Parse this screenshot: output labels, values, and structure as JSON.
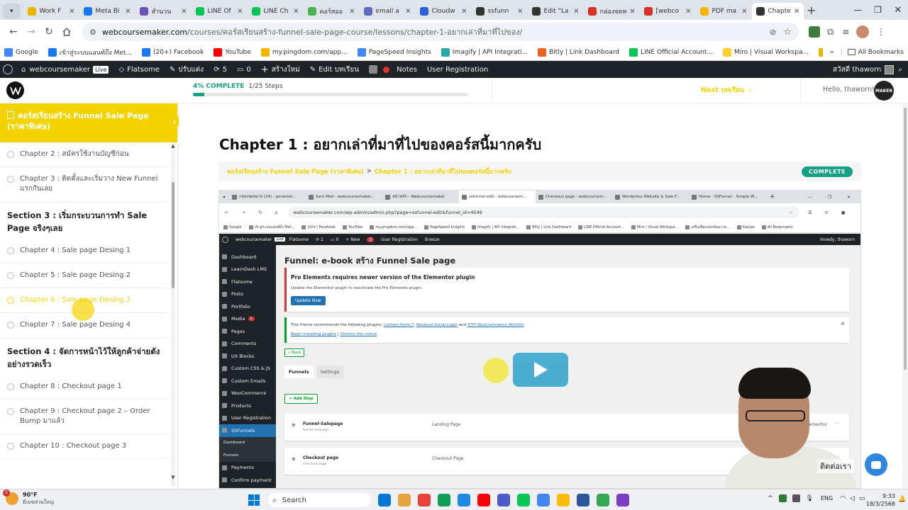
{
  "browser": {
    "tabs": [
      {
        "label": "Work F",
        "color": "#e8b400"
      },
      {
        "label": "Meta Bi",
        "color": "#1877f2"
      },
      {
        "label": "สำนวน",
        "color": "#6b4fbb"
      },
      {
        "label": "LINE Of",
        "color": "#06c755"
      },
      {
        "label": "LINE Ch",
        "color": "#06c755"
      },
      {
        "label": "คอร์สออ",
        "color": "#4caf50"
      },
      {
        "label": "email a",
        "color": "#5c6bc0"
      },
      {
        "label": "Cloudw",
        "color": "#2b5cd9"
      },
      {
        "label": "ssfunn",
        "color": "#333333"
      },
      {
        "label": "Edit \"La",
        "color": "#333333"
      },
      {
        "label": "กล่องจดห",
        "color": "#d93025"
      },
      {
        "label": "[webco",
        "color": "#d93025"
      },
      {
        "label": "PDF ma",
        "color": "#f4b400"
      },
      {
        "label": "Chapte",
        "color": "#333333"
      }
    ],
    "url_domain": "webcoursemaker.com",
    "url_path": "/courses/คอร์สเรียนสร้าง-funnel-sale-page-course/lessons/chapter-1-อยากเล่าที่มาที่ไปของ/",
    "bookmarks": [
      {
        "label": "Google",
        "color": "#4285f4"
      },
      {
        "label": "เข้าสู่ระบบแอนท์ถึง Met...",
        "color": "#1877f2"
      },
      {
        "label": "(20+) Facebook",
        "color": "#1877f2"
      },
      {
        "label": "YouTube",
        "color": "#ff0000"
      },
      {
        "label": "my.pingdom.com/app...",
        "color": "#f4b400"
      },
      {
        "label": "PageSpeed Insights",
        "color": "#4285f4"
      },
      {
        "label": "Imagify | API Integrati...",
        "color": "#2aa8a8"
      },
      {
        "label": "Bitly | Link Dashboard",
        "color": "#ee6123"
      },
      {
        "label": "LINE Official Account...",
        "color": "#06c755"
      },
      {
        "label": "Miro | Visual Workspa...",
        "color": "#ffd02f"
      },
      {
        "label": "เครื่องมือแปลงข้อความเป็...",
        "color": "#e8b400"
      },
      {
        "label": "Kaojao",
        "color": "#f4b400"
      }
    ],
    "all_bookmarks": "All Bookmarks"
  },
  "wpbar": {
    "site": "webcoursemaker",
    "live": "Live",
    "theme": "Flatsome",
    "customize": "ปรับแต่ง",
    "updates": "5",
    "comments": "0",
    "new": "สร้างใหม่",
    "edit": "Edit บทเรียน",
    "notes": "Notes",
    "user_reg": "User Registration",
    "howdy": "สวัสดี thaworn"
  },
  "progress": {
    "percent_label": "4% COMPLETE",
    "steps": "1/25 Steps",
    "fraction": 0.04,
    "next": "Next บทเรียน",
    "hello": "Hello, thaworn!",
    "maker": "MAKER"
  },
  "sidebar": {
    "course_title": "คอร์สเรียนสร้าง Funnel Sale Page (ราคาพิเศษ)",
    "items": [
      {
        "type": "lesson",
        "label": "Chapter 2 : สมัครใช้งานบัญชีก่อน"
      },
      {
        "type": "lesson",
        "label": "Chapter 3 : ติดตั้งและเริ่มวาง New Funnel แรกกันเลย"
      },
      {
        "type": "section",
        "label": "Section 3 : เริ่มกระบวนการทำ Sale Page จริงๆเลย"
      },
      {
        "type": "lesson",
        "label": "Chapter 4 : Sale page Desing 1"
      },
      {
        "type": "lesson",
        "label": "Chapter 5 : Sale page Desing 2"
      },
      {
        "type": "lesson-active",
        "label": "Chapter 6 : Sale page Desing 3"
      },
      {
        "type": "lesson",
        "label": "Chapter 7 : Sale page Desing 4"
      },
      {
        "type": "section",
        "label": "Section 4 : จัดการหน้าไว้ให้ลูกค้าจ่ายตังอย่างรวดเร็ว"
      },
      {
        "type": "lesson",
        "label": "Chapter 8 : Checkout page 1"
      },
      {
        "type": "lesson",
        "label": "Chapter 9 : Checkout page 2 – Order Bump มาแล้ว"
      },
      {
        "type": "lesson",
        "label": "Chapter 10 : Checkout page 3"
      }
    ]
  },
  "lesson": {
    "title": "Chapter 1 : อยากเล่าที่มาที่ไปของคอร์สนี้มากครับ",
    "breadcrumb_course": "คอร์สเรียนสร้าง Funnel Sale Page (ราคาพิเศษ)",
    "breadcrumb_sep": ">",
    "breadcrumb_lesson": "Chapter 1 : อยากเล่าที่มาที่ไปของคอร์สนี้มากครับ",
    "status": "COMPLETE",
    "chat_label": "ติดต่อเรา"
  },
  "video": {
    "tabs": [
      "กล่องจดหมาย (24) - poramet...",
      "Sent Mail - webcoursemaker...",
      "หน้าหลัก - Webcoursemaker",
      "ssfunnel-edit - webcoursem...",
      "Checkout page - webcoursem...",
      "Wordpress Website & Sale F...",
      "Home - SSFunnel - Simple W..."
    ],
    "url": "webcoursemaker.com/wp-admin/admin.php?page=ssfunnel-edit&funnel_id=4549",
    "bookmarks": [
      "Google",
      "เข้าสู่ระบบแอนท์ถึง Met...",
      "(20+) Facebook",
      "YouTube",
      "my.pingdom.com/app...",
      "PageSpeed Insights",
      "Imagify | API Integrati...",
      "Bitly | Link Dashboard",
      "LINE Official Account...",
      "Miro | Visual Workspa...",
      "เครื่องมือแปลงข้อความ...",
      "Kaojao",
      "All Bookmarks"
    ],
    "adminbar": {
      "site": "webcoursemaker",
      "live": "Live",
      "theme": "Flatsome",
      "updates": "2",
      "comments": "0",
      "new": "+ New",
      "notif": "2",
      "user_reg": "User Registration",
      "breeze": "Breeze",
      "howdy": "Howdy, thaworn"
    },
    "menu": [
      "Dashboard",
      "LearnDash LMS",
      "Flatsome",
      "Posts",
      "Portfolio",
      "Media",
      "Pages",
      "Comments",
      "UX Blocks",
      "Custom CSS & JS",
      "Custom Emails",
      "WooCommerce",
      "Products",
      "User Registration",
      "SSFunnels",
      "Dashboard",
      "Funnels",
      "Payments",
      "Confirm payment"
    ],
    "media_badge": "1",
    "heading": "Funnel: e-book สร้าง Funnel Sale page",
    "notice1_title": "Pro Elements requires newer version of the Elementor plugin",
    "notice1_text": "Update the Elementor plugin to reactivate the Pro Elements plugin.",
    "update_btn": "Update Now",
    "notice2_text1": "This theme recommends the following plugins:",
    "notice2_link1": "Contact Form 7",
    "notice2_link2": "Nextend Social Login",
    "notice2_and": "and",
    "notice2_link3": "YITH WooCommerce Wishlist",
    "notice2_begin": "Begin installing plugins",
    "notice2_sep": "|",
    "notice2_dismiss": "Dismiss this notice",
    "back": "« Back",
    "tab_funnels": "Funnels",
    "tab_settings": "Settings",
    "add_step": "+ Add Step",
    "steps": [
      {
        "name": "Funnel-Salepage",
        "slug": "funnel-salepage",
        "type": "Landing Page",
        "edit": "Edit with Elementor"
      },
      {
        "name": "Checkout page",
        "slug": "checkout-page",
        "type": "Checkout Page",
        "edit": "Edit with E"
      }
    ]
  },
  "taskbar": {
    "weather_temp": "90°F",
    "weather_desc": "มีเมฆส่วนใหญ่",
    "weather_badge": "5",
    "search": "Search",
    "lang": "ENG",
    "time": "9:33",
    "date": "18/3/2568",
    "app_colors": [
      "#0078d4",
      "#e8a33d",
      "#ea4335",
      "#0f9d58",
      "#1e88e5",
      "#ff0000",
      "#5059c9",
      "#06c755",
      "#4285f4",
      "#fbbc05",
      "#2b579a",
      "#34a853",
      "#7b3fc4"
    ]
  },
  "colors": {
    "accent_yellow": "#f3d300",
    "complete_green": "#16a085",
    "wp_dark": "#1d2327",
    "wp_blue": "#2271b1"
  }
}
